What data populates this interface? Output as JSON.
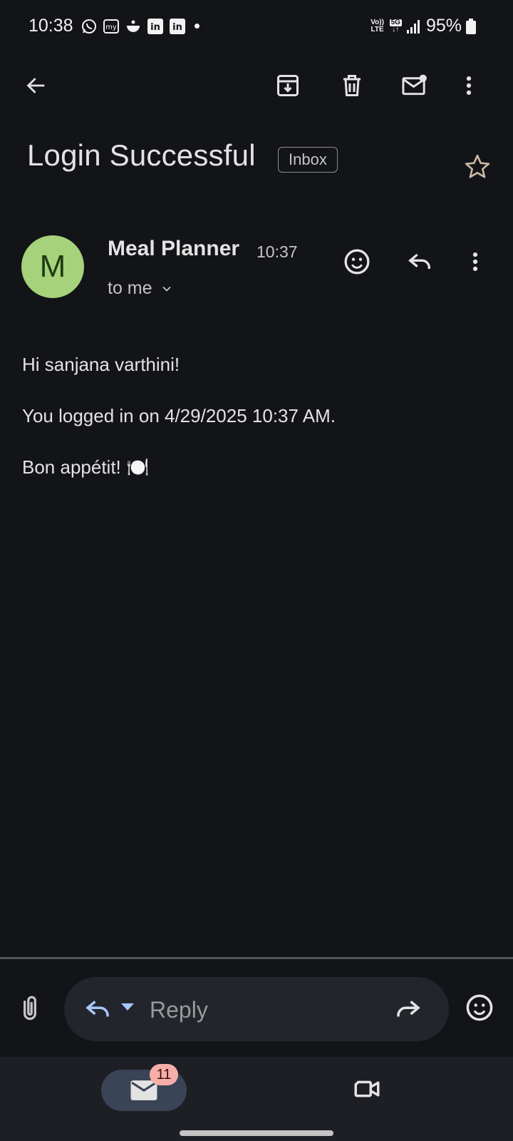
{
  "status_bar": {
    "time": "10:38",
    "notifications": [
      "whatsapp-icon",
      "myntra-icon",
      "swiggy-icon",
      "linkedin-icon",
      "linkedin-icon"
    ],
    "network": "5G",
    "volte": "Vo)) LTE",
    "battery": "95%"
  },
  "toolbar": {
    "actions": [
      "back",
      "archive",
      "delete",
      "mark-unread",
      "more"
    ]
  },
  "email": {
    "subject": "Login Successful",
    "label": "Inbox",
    "sender": {
      "initial": "M",
      "name": "Meal Planner",
      "time": "10:37",
      "recipient": "to me"
    },
    "body": [
      "Hi sanjana varthini!",
      "You logged in on 4/29/2025 10:37 AM.",
      "Bon appétit! 🍽️"
    ]
  },
  "reply_bar": {
    "placeholder": "Reply"
  },
  "bottom_nav": {
    "mail_badge": "11"
  },
  "colors": {
    "background": "#131418",
    "avatar": "#a5d27a",
    "accent": "#a8c7fa",
    "badge": "#f6aea9"
  }
}
